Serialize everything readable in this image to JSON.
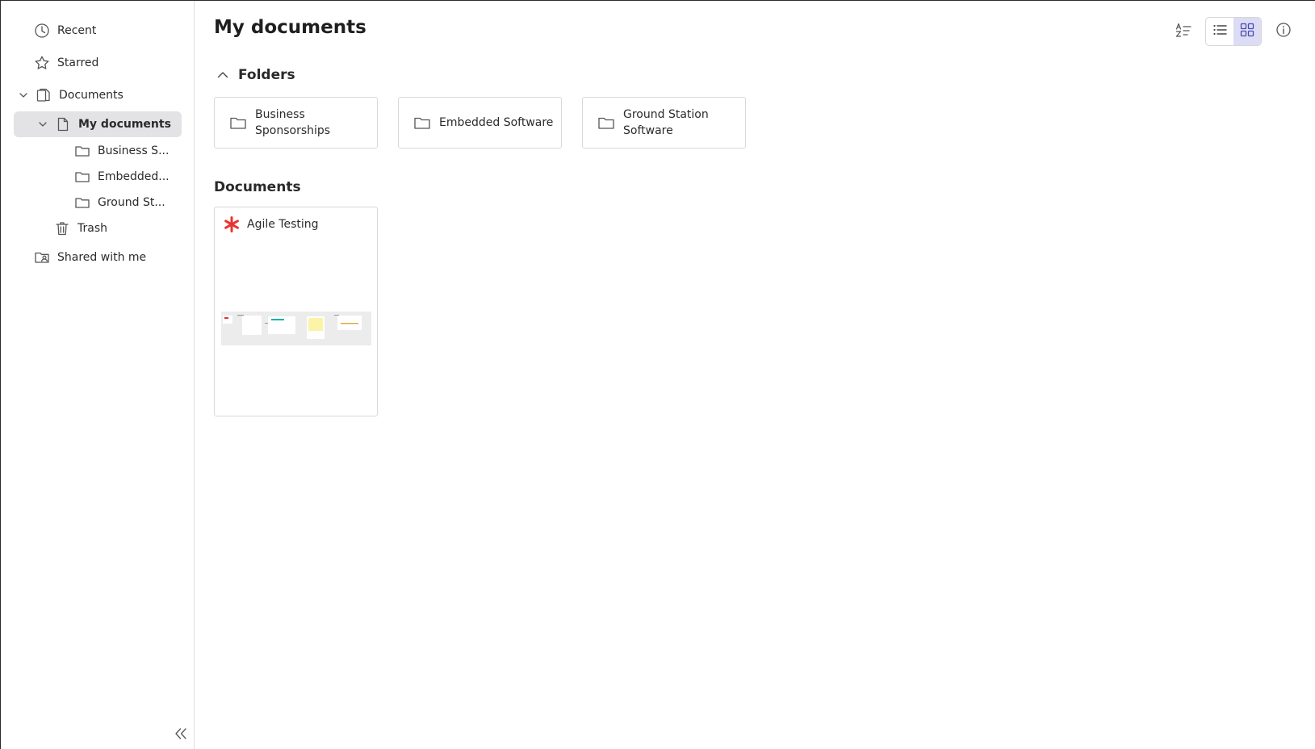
{
  "sidebar": {
    "recent": "Recent",
    "starred": "Starred",
    "documents": "Documents",
    "my_documents": "My documents",
    "subfolders": [
      "Business S...",
      "Embedded...",
      "Ground St..."
    ],
    "trash": "Trash",
    "shared": "Shared with me"
  },
  "main": {
    "title": "My documents",
    "folders_heading": "Folders",
    "folders": [
      {
        "line1": "Business",
        "line2": "Sponsorships"
      },
      {
        "line1": "Embedded Software",
        "line2": ""
      },
      {
        "line1": "Ground Station",
        "line2": "Software"
      }
    ],
    "documents_heading": "Documents",
    "documents": [
      {
        "name": "Agile Testing"
      }
    ]
  },
  "colors": {
    "selected_bg": "#e3e3e6",
    "accent": "#dcdcf4",
    "doc_icon": "#e8352f"
  },
  "icons": [
    "clock-icon",
    "star-icon",
    "documents-icon",
    "file-icon",
    "folder-icon",
    "trash-icon",
    "shared-icon",
    "sort-icon",
    "list-view-icon",
    "grid-view-icon",
    "info-icon",
    "double-chevron-left-icon",
    "chevron-up-icon",
    "asterisk-icon"
  ]
}
